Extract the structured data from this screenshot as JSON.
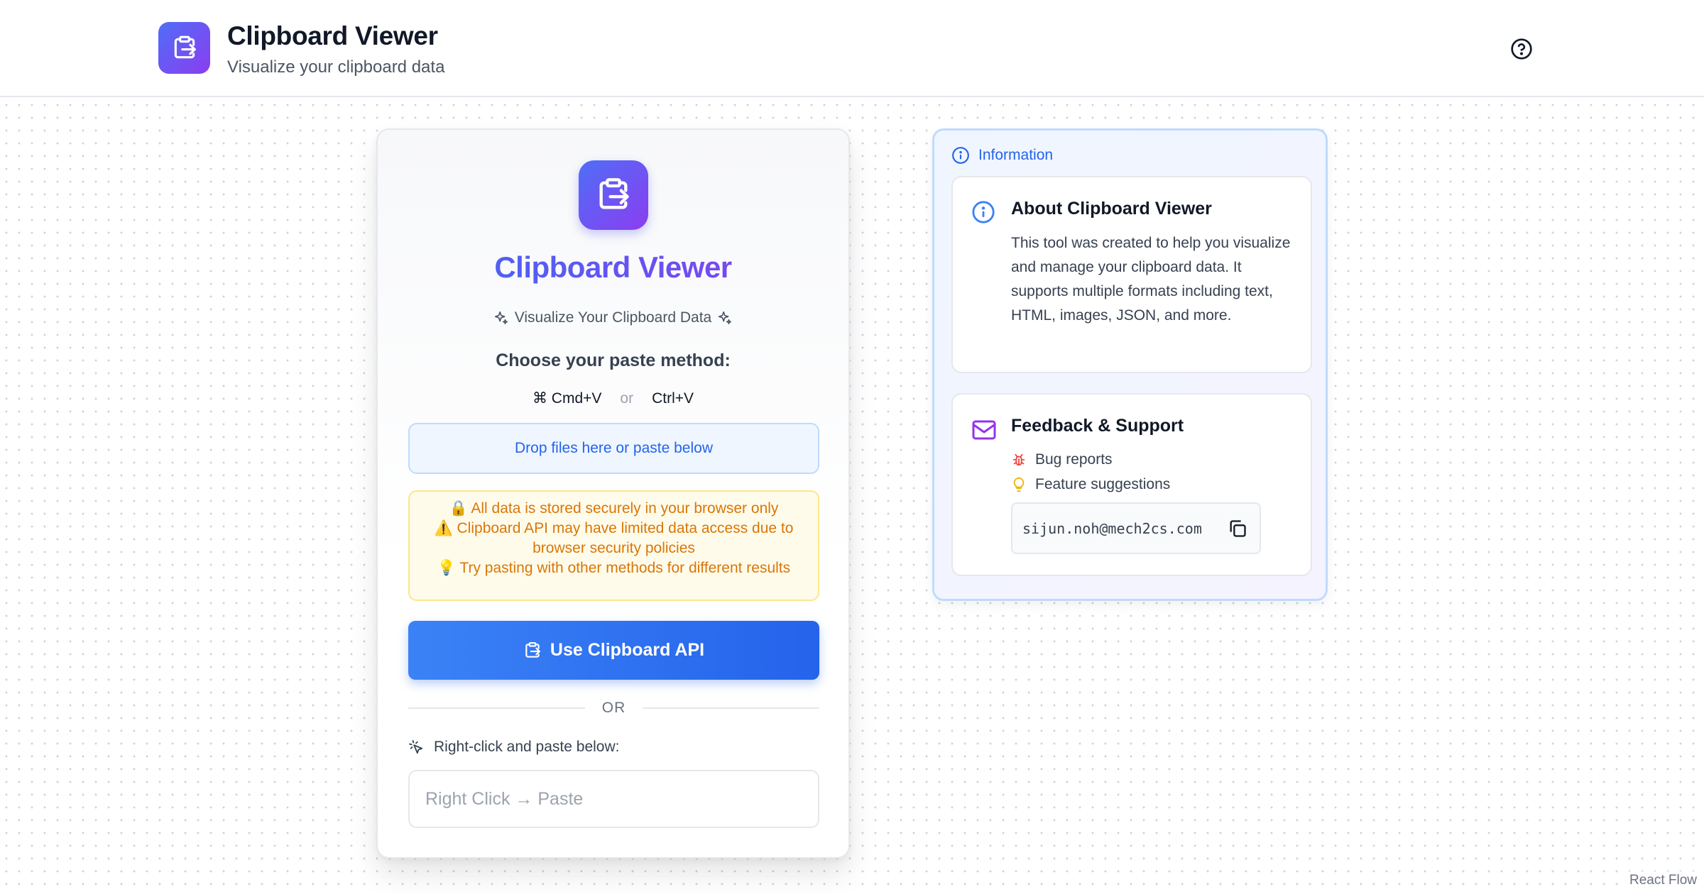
{
  "header": {
    "title": "Clipboard Viewer",
    "subtitle": "Visualize your clipboard data"
  },
  "main_card": {
    "title": "Clipboard Viewer",
    "tagline": "Visualize Your Clipboard Data",
    "method_heading": "Choose your paste method:",
    "shortcut_mac": "⌘ Cmd+V",
    "shortcut_or": "or",
    "shortcut_win": "Ctrl+V",
    "dropzone_label": "Drop files here or paste below",
    "notices": [
      "🔒 All data is stored securely in your browser only",
      "⚠️ Clipboard API may have limited data access due to browser security policies",
      "💡 Try pasting with other methods for different results"
    ],
    "api_button_label": "Use Clipboard API",
    "divider_label": "OR",
    "right_click_label": "Right-click and paste below:",
    "right_click_placeholder": "Right Click → Paste"
  },
  "info_panel": {
    "heading": "Information",
    "about": {
      "title": "About Clipboard Viewer",
      "text": "This tool was created to help you visualize and manage your clipboard data. It supports multiple formats including text, HTML, images, JSON, and more."
    },
    "feedback": {
      "title": "Feedback & Support",
      "items": [
        "Bug reports",
        "Feature suggestions"
      ],
      "email": "sijun.noh@mech2cs.com"
    }
  },
  "attribution": "React Flow",
  "colors": {
    "brand_gradient_start": "#4f6ef7",
    "brand_gradient_end": "#8b3df0",
    "primary_blue": "#2563eb",
    "notice_amber": "#d97706"
  }
}
